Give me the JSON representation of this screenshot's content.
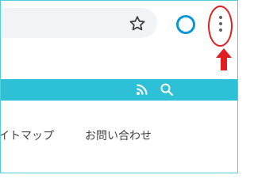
{
  "browser": {
    "star_icon": "star-outline-icon",
    "profile_icon": "profile-ring-icon",
    "menu_icon": "vertical-ellipsis-icon",
    "profile_color": "#0a95d8"
  },
  "annotation": {
    "highlight_color": "#e02020",
    "arrow_icon": "red-up-arrow"
  },
  "site_header": {
    "background": "#2ec0d6",
    "rss_icon": "rss-icon",
    "search_icon": "search-icon"
  },
  "nav": {
    "items": [
      {
        "label": "イトマップ"
      },
      {
        "label": "お問い合わせ"
      }
    ]
  }
}
